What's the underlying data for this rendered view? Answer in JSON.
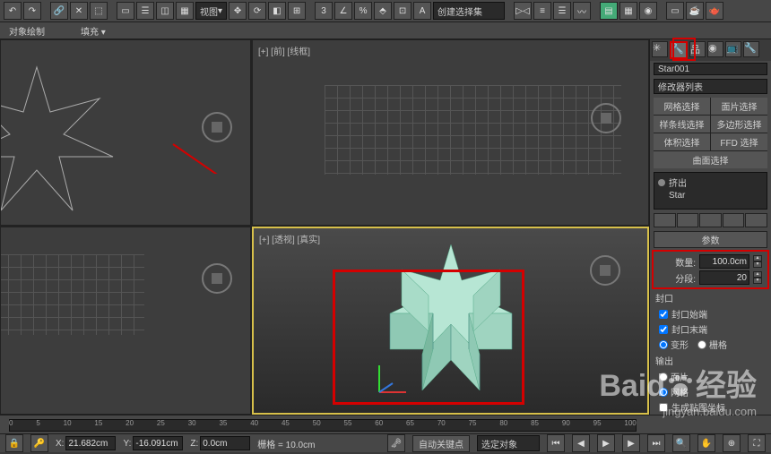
{
  "toolbar": {
    "view_dropdown": "视图",
    "selection_dropdown": "创建选择集"
  },
  "secondbar": {
    "obj_ctrl": "对象绘制",
    "fill": "填充"
  },
  "viewports": {
    "top_left_label": "",
    "top_right_label": "[+] [前] [线框]",
    "perspective_label": "[+] [透视] [真实]"
  },
  "side": {
    "object_name": "Star001",
    "modifier_list": "修改器列表",
    "selection": {
      "mesh": "网格选择",
      "face": "面片选择",
      "spline": "样条线选择",
      "poly": "多边形选择",
      "vol": "体积选择",
      "ffd": "FFD 选择",
      "surf": "曲面选择"
    },
    "stack": {
      "mod1": "挤出",
      "base": "Star"
    },
    "rollout_params": "参数",
    "amount_label": "数量:",
    "amount_value": "100.0cm",
    "segments_label": "分段:",
    "segments_value": "20",
    "cap_label": "封口",
    "cap_start": "封口始端",
    "cap_end": "封口末端",
    "morph": "变形",
    "grid": "栅格",
    "output_label": "输出",
    "patch": "面片",
    "mesh": "网格",
    "localcoord": "生成贴图坐标"
  },
  "status": {
    "x_label": "X:",
    "x_val": "21.682cm",
    "y_label": "Y:",
    "y_val": "-16.091cm",
    "z_label": "Z:",
    "z_val": "0.0cm",
    "grid_label": "栅格 = 10.0cm",
    "autokey": "自动关键点",
    "selected": "选定对象"
  },
  "watermark": {
    "main": "Baid",
    "suffix": "经验",
    "url": "jingyan.baidu.com"
  },
  "timeline": {
    "ticks": [
      "0",
      "5",
      "10",
      "15",
      "20",
      "25",
      "30",
      "35",
      "40",
      "45",
      "50",
      "55",
      "60",
      "65",
      "70",
      "75",
      "80",
      "85",
      "90",
      "95",
      "100"
    ]
  }
}
